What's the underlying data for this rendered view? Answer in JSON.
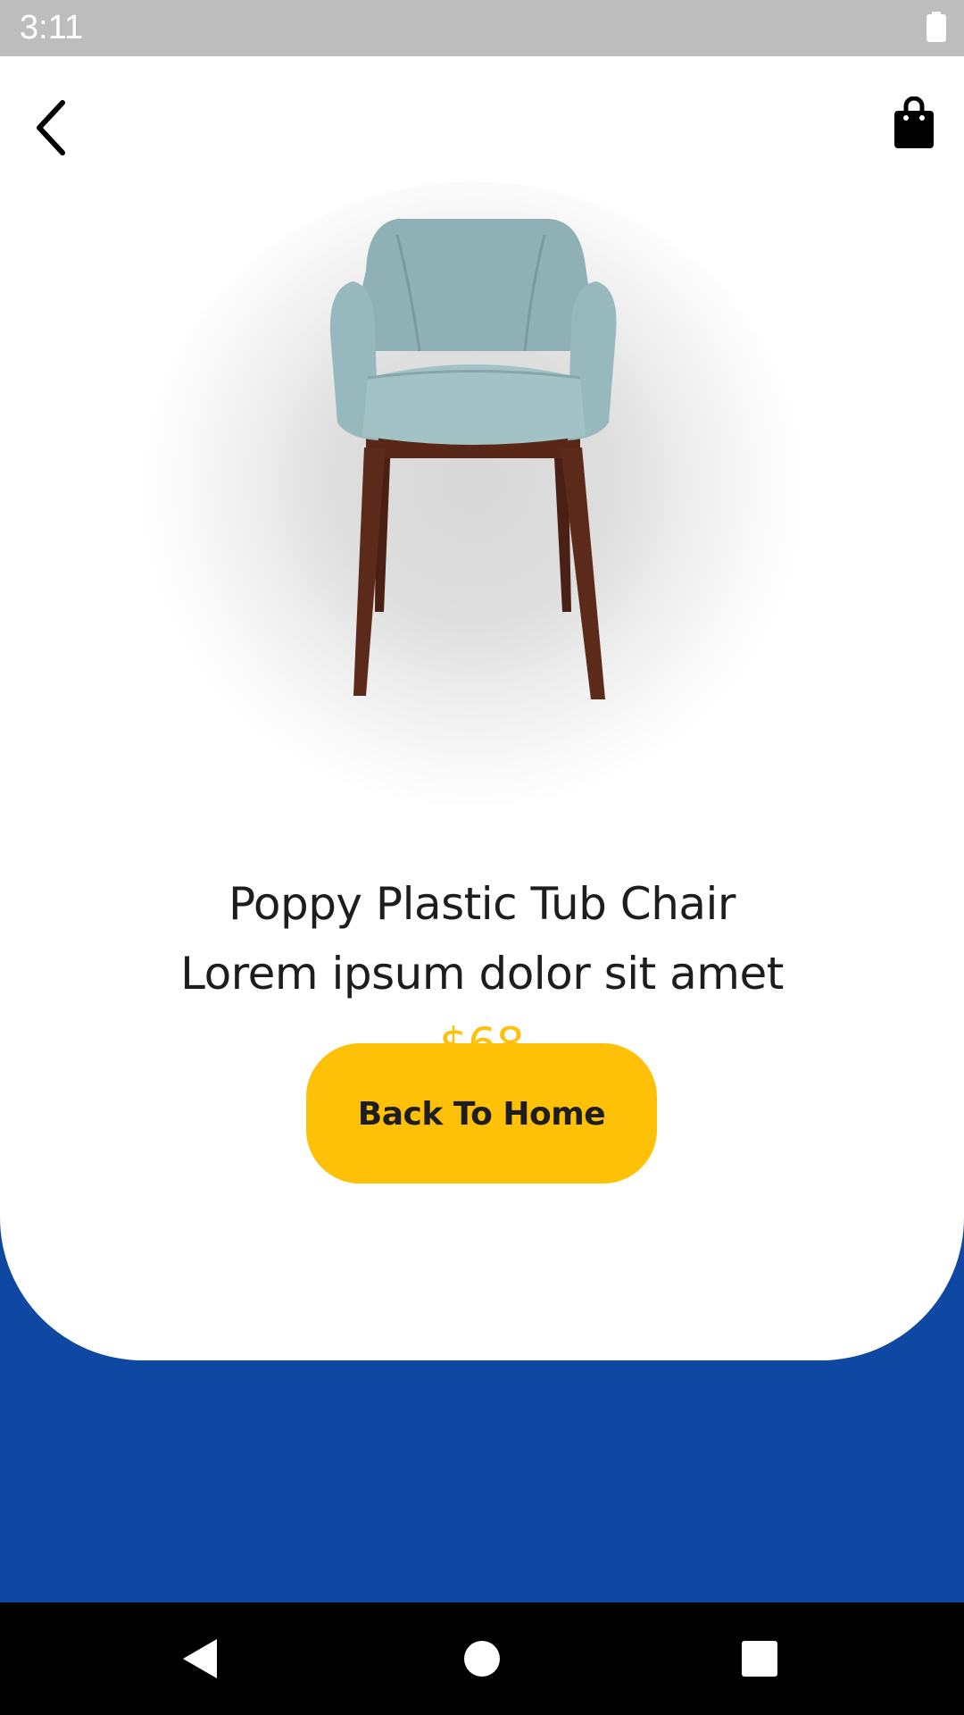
{
  "status_bar": {
    "time": "3:11",
    "battery_icon": "battery-full-icon"
  },
  "header": {
    "back_icon": "chevron-left-icon",
    "cart_icon": "shopping-bag-icon"
  },
  "product": {
    "image_icon": "armchair-image",
    "title": "Poppy Plastic Tub Chair",
    "subtitle": "Lorem ipsum dolor sit amet",
    "price": "$68"
  },
  "actions": {
    "home_button_label": "Back To Home"
  },
  "nav_bar": {
    "back_icon": "nav-back-triangle-icon",
    "home_icon": "nav-home-circle-icon",
    "recents_icon": "nav-recents-square-icon"
  },
  "colors": {
    "accent": "#ffc107",
    "background_blue": "#0f48a2",
    "text": "#1d1d1d",
    "status_bar": "#bdbdbd"
  }
}
